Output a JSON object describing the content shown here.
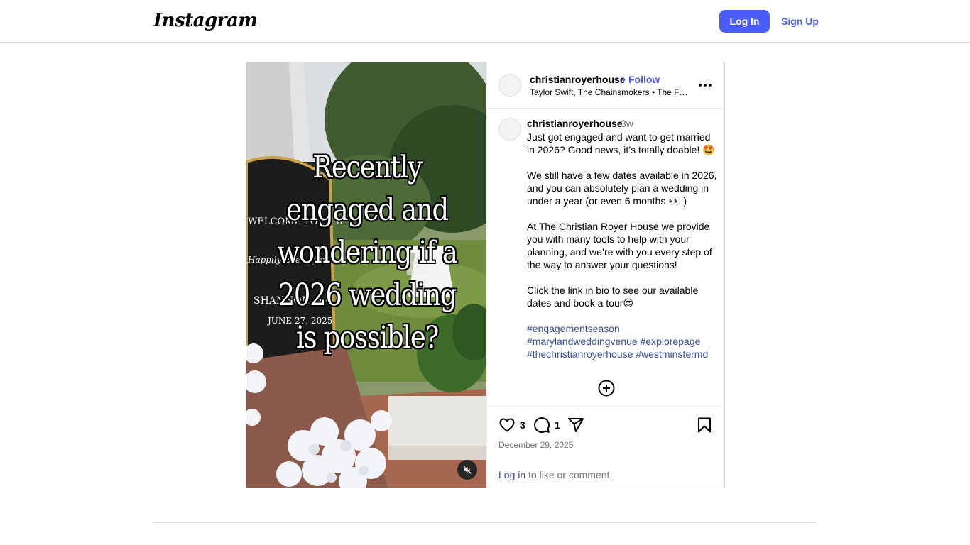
{
  "nav": {
    "logo_text": "Instagram",
    "login_label": "Log In",
    "signup_label": "Sign Up",
    "accent_color": "#4a5df9"
  },
  "media": {
    "overlay_text": "Recently engaged and wondering if a 2026 wedding is possible?",
    "sign_text": [
      "WELCOME TO OUR",
      "Happily Ever After",
      "SHANNON & C.J.",
      "JUNE 27, 2025"
    ],
    "mute_icon": "speaker-muted-icon"
  },
  "header": {
    "username": "christianroyerhouse",
    "separator": "•",
    "follow_label": "Follow",
    "music": "Taylor Swift, The Chainsmokers • The Fate of Ophelia",
    "more_icon": "more-options-icon"
  },
  "caption": {
    "username": "christianroyerhouse",
    "time": "3w",
    "paragraphs": [
      "Just got engaged and want to get married in 2026? Good news, it’s totally doable! 🤩",
      "We still have a few dates available in 2026, and you can absolutely plan a wedding in under a year (or even 6 months 👀 )",
      "At The Christian Royer House we provide you with many tools to help with your planning, and we’re with you every step of the way to answer your questions!",
      "Click the link in bio to see our available dates and book a tour😍"
    ],
    "hashtags": [
      "#engagementseason",
      "#marylandweddingvenue",
      "#explorepage",
      "#thechristianroyerhouse",
      "#westminstermd"
    ],
    "load_more_icon": "plus-circle-icon"
  },
  "actions": {
    "likes": "3",
    "comments": "1",
    "date": "December 29, 2025",
    "login_link": "Log in",
    "login_suffix": " to like or comment."
  }
}
